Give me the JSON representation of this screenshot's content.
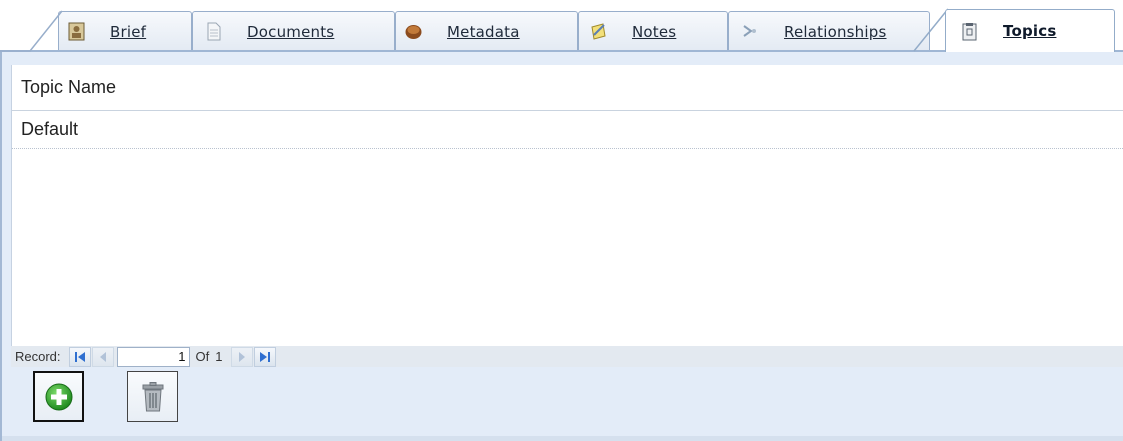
{
  "tabs": [
    {
      "label": "Brief",
      "icon": "brief-icon",
      "active": false
    },
    {
      "label": "Documents",
      "icon": "documents-icon",
      "active": false
    },
    {
      "label": "Metadata",
      "icon": "metadata-icon",
      "active": false
    },
    {
      "label": "Notes",
      "icon": "notes-icon",
      "active": false
    },
    {
      "label": "Relationships",
      "icon": "relationships-icon",
      "active": false
    },
    {
      "label": "Topics",
      "icon": "topics-icon",
      "active": true
    }
  ],
  "grid": {
    "header": "Topic Name",
    "rows": [
      "Default"
    ]
  },
  "record_nav": {
    "label": "Record:",
    "current": "1",
    "of_label": "Of",
    "total": "1"
  },
  "actions": {
    "add_icon": "add-circle-icon",
    "delete_icon": "trash-icon"
  },
  "colors": {
    "tab_border": "#98aecb",
    "panel_bg": "#e3ecf8",
    "add_green": "#2f9e2f",
    "nav_blue": "#2f6fd0"
  }
}
